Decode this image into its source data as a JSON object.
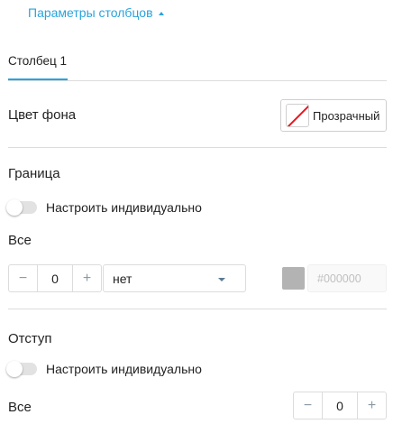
{
  "section_toggle": {
    "label": "Параметры столбцов",
    "icon": "caret-up-icon"
  },
  "tabs": [
    {
      "label": "Столбец 1",
      "active": true
    }
  ],
  "background": {
    "label": "Цвет фона",
    "button_label": "Прозрачный"
  },
  "border": {
    "title": "Граница",
    "individual_toggle_label": "Настроить индивидуально",
    "individual_toggle_on": false,
    "all_label": "Все",
    "width_value": "0",
    "minus_label": "−",
    "plus_label": "+",
    "style_value": "нет",
    "color": "#b3b3b3",
    "color_placeholder": "#000000"
  },
  "padding": {
    "title": "Отступ",
    "individual_toggle_label": "Настроить индивидуально",
    "individual_toggle_on": false,
    "all_label": "Все",
    "value": "0",
    "minus_label": "−",
    "plus_label": "+"
  },
  "colors": {
    "accent": "#2aa3dd",
    "transparent_slash": "#e8171f"
  }
}
